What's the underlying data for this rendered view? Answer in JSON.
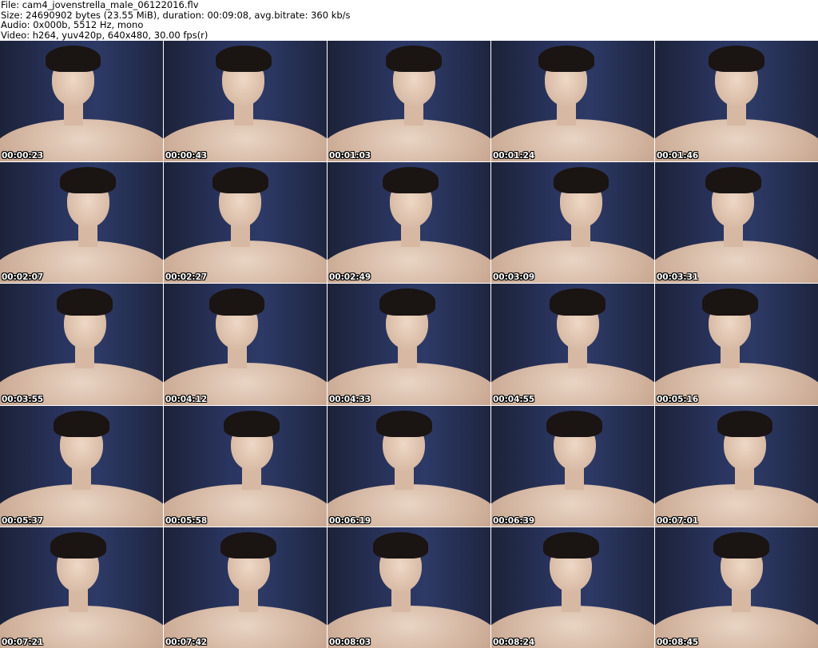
{
  "header": {
    "file": "File: cam4_jovenstrella_male_06122016.flv",
    "size": "Size: 24690902 bytes (23.55 MiB), duration: 00:09:08, avg.bitrate: 360 kb/s",
    "audio": "Audio: 0x000b, 5512 Hz, mono",
    "video": "Video: h264, yuv420p, 640x480, 30.00 fps(r)"
  },
  "thumbnails": [
    "00:00:23",
    "00:00:43",
    "00:01:03",
    "00:01:24",
    "00:01:46",
    "00:02:07",
    "00:02:27",
    "00:02:49",
    "00:03:09",
    "00:03:31",
    "00:03:55",
    "00:04:12",
    "00:04:33",
    "00:04:55",
    "00:05:16",
    "00:05:37",
    "00:05:58",
    "00:06:19",
    "00:06:39",
    "00:07:01",
    "00:07:21",
    "00:07:42",
    "00:08:03",
    "00:08:24",
    "00:08:45"
  ]
}
